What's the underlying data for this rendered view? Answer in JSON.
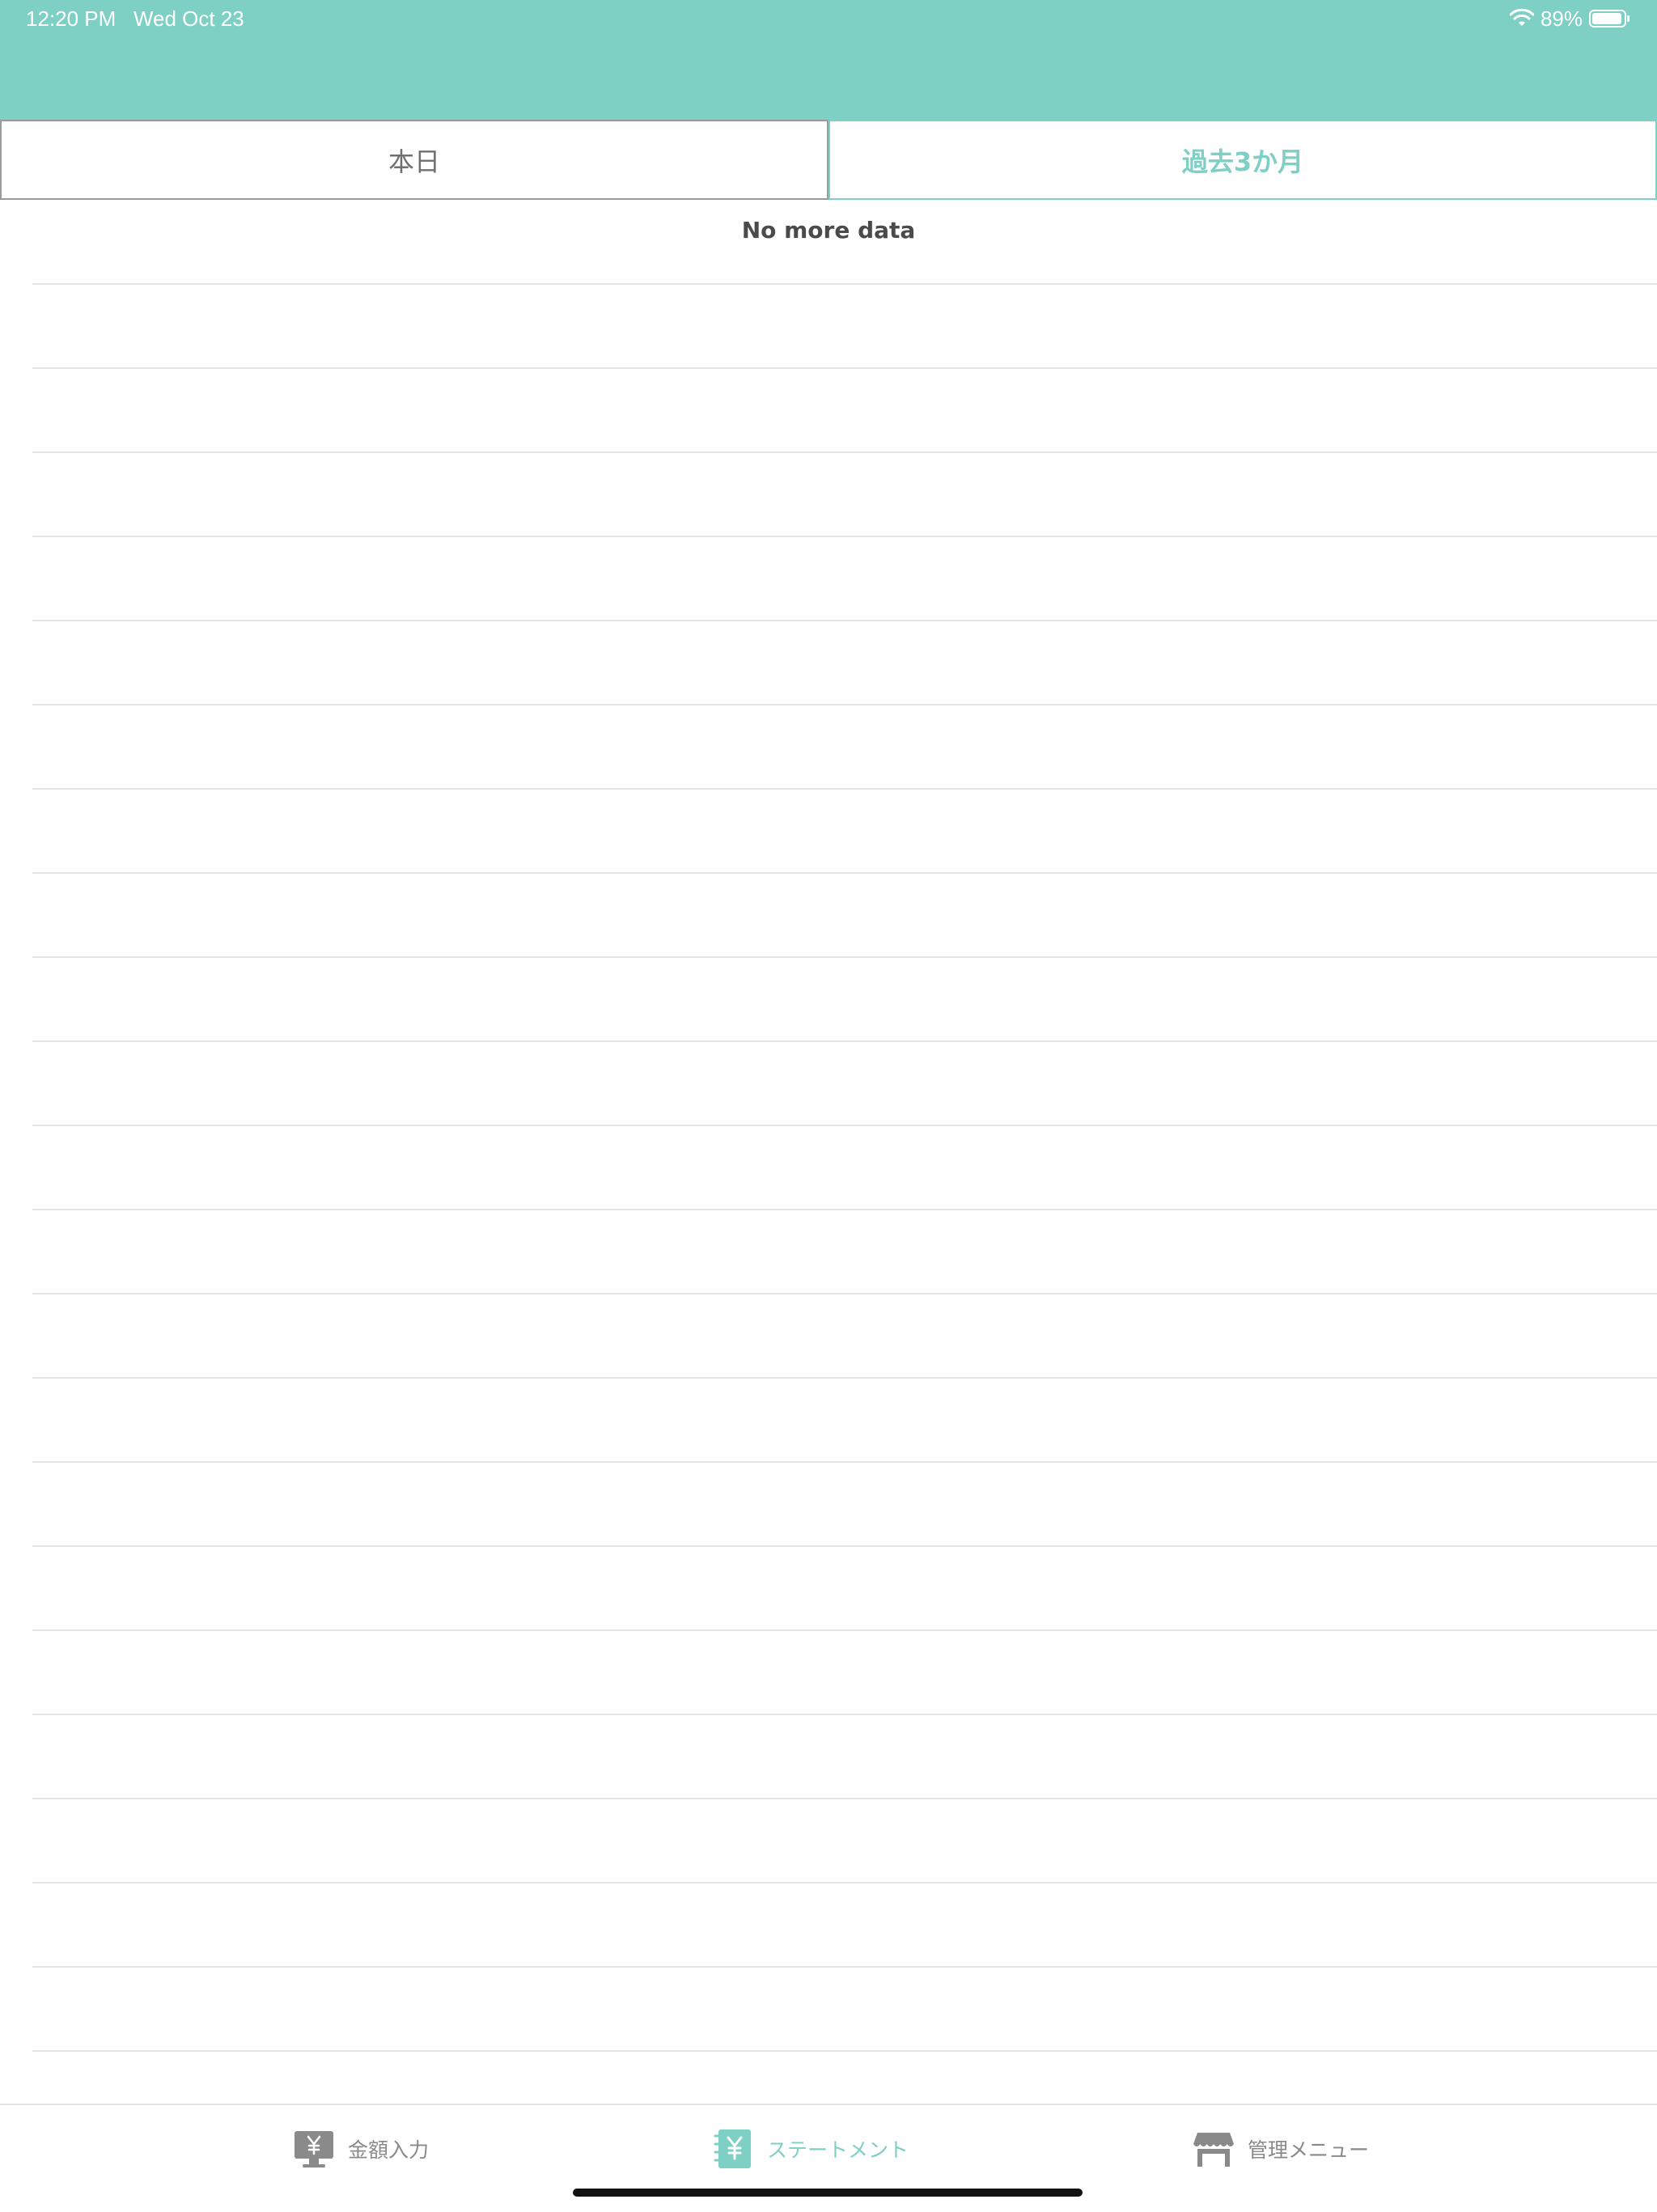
{
  "status_bar": {
    "time": "12:20 PM   Wed Oct 23",
    "battery": "89%"
  },
  "segments": {
    "today": "本日",
    "past_3_months": "過去3か月",
    "selected": "過去3か月"
  },
  "list": {
    "empty_message": "No more data"
  },
  "tabbar": {
    "amount_input": "金額入力",
    "statement": "ステートメント",
    "admin_menu": "管理メニュー",
    "selected": "ステートメント"
  },
  "colors": {
    "accent": "#7ecfc4",
    "inactive": "#8a8a8a",
    "separator": "#e6e6e6"
  },
  "icons": {
    "amount_input": "yen-monitor-icon",
    "statement": "yen-notebook-icon",
    "admin_menu": "store-icon"
  }
}
